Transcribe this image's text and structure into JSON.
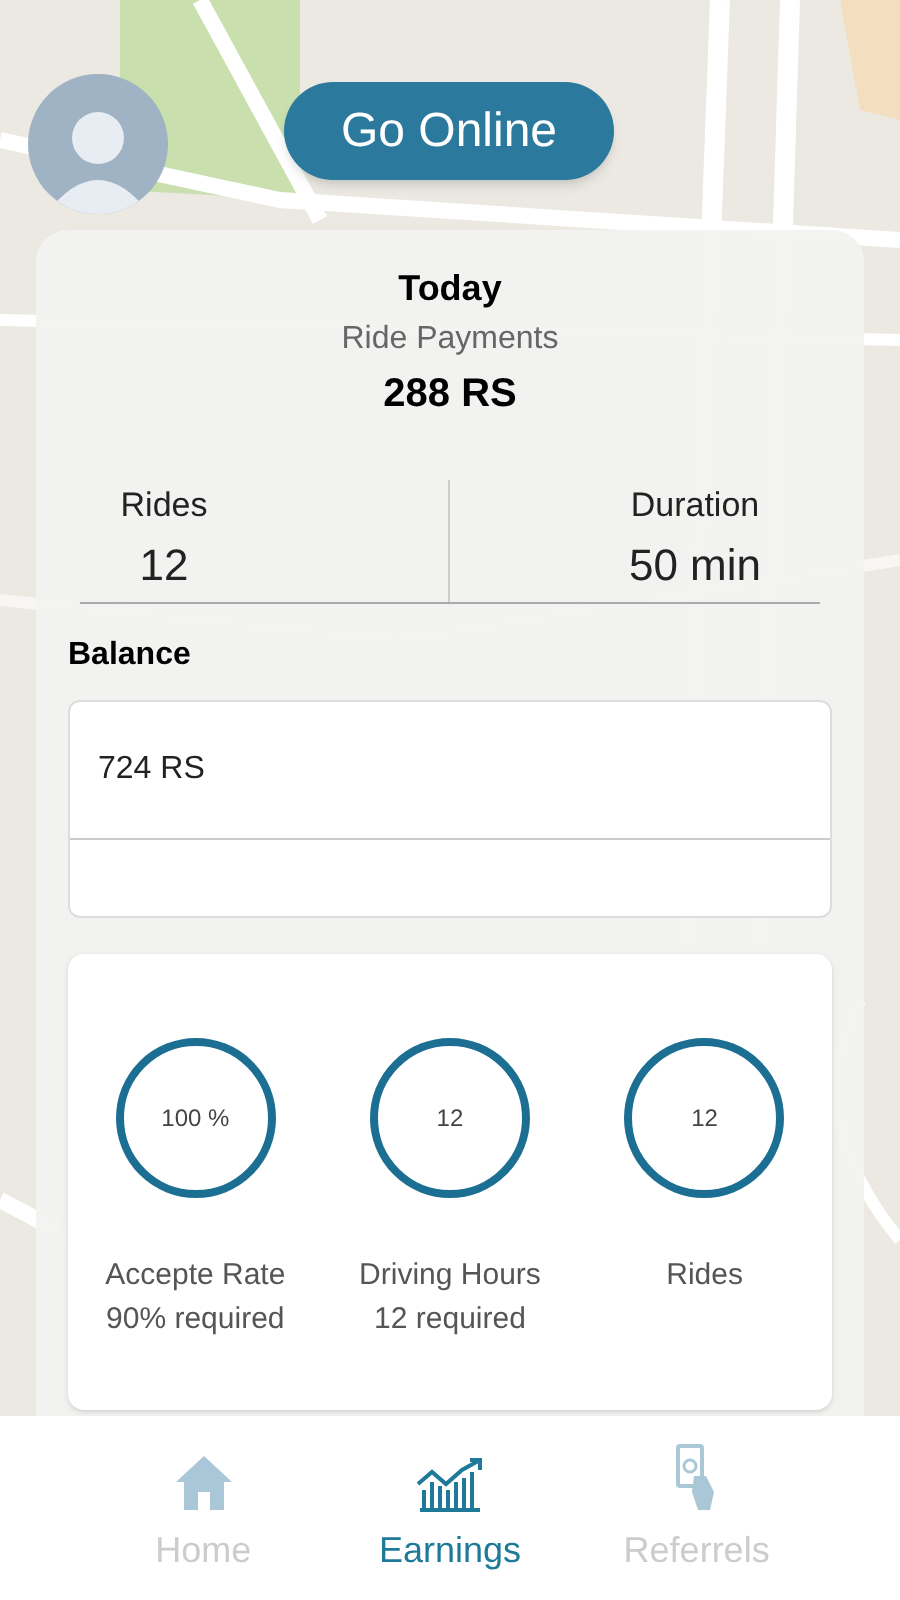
{
  "go_online_button": "Go Online",
  "summary": {
    "period": "Today",
    "label": "Ride Payments",
    "amount": "288 RS"
  },
  "stats": [
    {
      "label": "Rides",
      "value": "12"
    },
    {
      "label": "Duration",
      "value": "50 min"
    }
  ],
  "balance": {
    "label": "Balance",
    "value": "724 RS"
  },
  "metrics": [
    {
      "value": "100 %",
      "label": "Accepte Rate",
      "requirement": "90% required"
    },
    {
      "value": "12",
      "label": "Driving Hours",
      "requirement": "12 required"
    },
    {
      "value": "12",
      "label": "Rides"
    }
  ],
  "nav": [
    {
      "kind": "home",
      "label": "Home",
      "selected": false
    },
    {
      "kind": "earnings",
      "label": "Earnings",
      "selected": true
    },
    {
      "kind": "referrals",
      "label": "Referrels",
      "selected": false
    }
  ]
}
